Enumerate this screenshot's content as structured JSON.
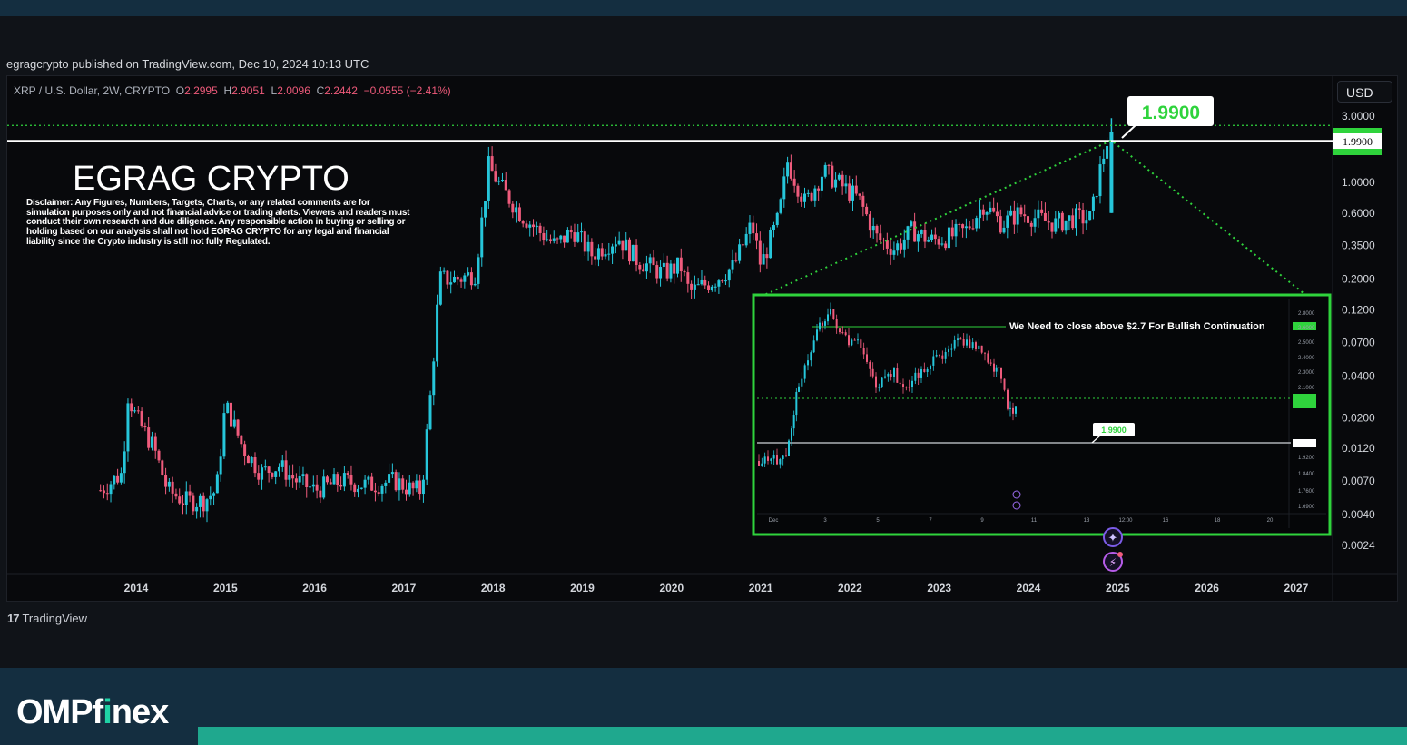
{
  "header": {
    "published": "egragcrypto published on TradingView.com, Dec 10, 2024 10:13 UTC"
  },
  "ohlc": {
    "symbol": "XRP / U.S. Dollar, 2W, CRYPTO",
    "open_label": "O",
    "open": "2.2995",
    "high_label": "H",
    "high": "2.9051",
    "low_label": "L",
    "low": "2.0096",
    "close_label": "C",
    "close": "2.2442",
    "change": "−0.0555 (−2.41%)"
  },
  "currency_button": "USD",
  "watermark": {
    "title": "EGRAG CRYPTO",
    "disclaimer": "Disclaimer: Any Figures, Numbers, Targets, Charts, or any related comments are for simulation purposes only and not financial advice or trading alerts. Viewers and readers must conduct their own research and due diligence. Any responsible action in buying or selling or holding based on our analysis shall not hold EGRAG CRYPTO for any legal and financial liability since the Crypto industry is still not fully Regulated."
  },
  "callout": {
    "label": "1.9900"
  },
  "price_tags": {
    "level": "1.9900"
  },
  "inset": {
    "annotation": "We Need to close above $2.7 For Bullish Continuation",
    "callout": "1.9900",
    "y_ticks": [
      "2.8000",
      "2.6000",
      "2.5000",
      "2.4000",
      "2.3000",
      "2.1000",
      "1.9200",
      "1.8400",
      "1.7600",
      "1.6900"
    ],
    "x_ticks": [
      "Dec",
      "3",
      "5",
      "7",
      "9",
      "11",
      "13",
      "12:00",
      "16",
      "18",
      "20"
    ]
  },
  "brand": {
    "tv": "TradingView",
    "site_a": "OMPf",
    "site_b": "i",
    "site_c": "nex"
  },
  "colors": {
    "up": "#26c6da",
    "down": "#ef5b7c",
    "green": "#2fd33c",
    "bg": "#08090c"
  },
  "chart_data": {
    "type": "candlestick",
    "title": "",
    "scale": "log",
    "interval": "2W",
    "y_ticks": [
      3.0,
      2.0,
      1.0,
      0.6,
      0.35,
      0.2,
      0.12,
      0.07,
      0.04,
      0.02,
      0.012,
      0.007,
      0.004,
      0.0024
    ],
    "y_tick_labels": [
      "3.0000",
      "2.0000",
      "1.0000",
      "0.6000",
      "0.3500",
      "0.2000",
      "0.1200",
      "0.0700",
      "0.0400",
      "0.0200",
      "0.0120",
      "0.0070",
      "0.0040",
      "0.0024"
    ],
    "x_ticks": [
      "2014",
      "2015",
      "2016",
      "2017",
      "2018",
      "2019",
      "2020",
      "2021",
      "2022",
      "2023",
      "2024",
      "2025",
      "2026",
      "2027"
    ],
    "ylim": [
      0.0024,
      3.0
    ],
    "horizontal_level": 1.99,
    "current_price": 2.2442,
    "trendline_points": [
      {
        "x": 2021.0,
        "y": 0.15
      },
      {
        "x": 2024.93,
        "y": 2.0
      },
      {
        "x": 2027.25,
        "y": 0.13
      }
    ],
    "price_path": [
      [
        2013.6,
        0.006
      ],
      [
        2013.85,
        0.008
      ],
      [
        2013.9,
        0.03
      ],
      [
        2014.0,
        0.02
      ],
      [
        2014.2,
        0.012
      ],
      [
        2014.35,
        0.006
      ],
      [
        2014.55,
        0.005
      ],
      [
        2014.75,
        0.005
      ],
      [
        2014.9,
        0.006
      ],
      [
        2015.0,
        0.025
      ],
      [
        2015.2,
        0.012
      ],
      [
        2015.4,
        0.008
      ],
      [
        2015.6,
        0.009
      ],
      [
        2015.8,
        0.007
      ],
      [
        2016.0,
        0.006
      ],
      [
        2016.3,
        0.007
      ],
      [
        2016.6,
        0.0065
      ],
      [
        2016.9,
        0.007
      ],
      [
        2017.1,
        0.006
      ],
      [
        2017.2,
        0.006
      ],
      [
        2017.3,
        0.03
      ],
      [
        2017.4,
        0.2
      ],
      [
        2017.6,
        0.2
      ],
      [
        2017.8,
        0.22
      ],
      [
        2017.95,
        1.3
      ],
      [
        2018.1,
        0.9
      ],
      [
        2018.3,
        0.6
      ],
      [
        2018.5,
        0.45
      ],
      [
        2018.7,
        0.35
      ],
      [
        2018.9,
        0.45
      ],
      [
        2019.1,
        0.3
      ],
      [
        2019.4,
        0.4
      ],
      [
        2019.6,
        0.28
      ],
      [
        2019.9,
        0.22
      ],
      [
        2020.1,
        0.25
      ],
      [
        2020.2,
        0.16
      ],
      [
        2020.5,
        0.2
      ],
      [
        2020.7,
        0.25
      ],
      [
        2020.9,
        0.5
      ],
      [
        2021.0,
        0.25
      ],
      [
        2021.2,
        0.55
      ],
      [
        2021.3,
        1.4
      ],
      [
        2021.5,
        0.7
      ],
      [
        2021.7,
        1.2
      ],
      [
        2021.9,
        0.95
      ],
      [
        2022.1,
        0.75
      ],
      [
        2022.3,
        0.4
      ],
      [
        2022.5,
        0.33
      ],
      [
        2022.7,
        0.45
      ],
      [
        2022.9,
        0.38
      ],
      [
        2023.1,
        0.4
      ],
      [
        2023.3,
        0.45
      ],
      [
        2023.5,
        0.7
      ],
      [
        2023.7,
        0.5
      ],
      [
        2023.9,
        0.6
      ],
      [
        2024.1,
        0.55
      ],
      [
        2024.3,
        0.5
      ],
      [
        2024.5,
        0.55
      ],
      [
        2024.7,
        0.55
      ],
      [
        2024.8,
        1.2
      ],
      [
        2024.9,
        2.24
      ]
    ]
  }
}
